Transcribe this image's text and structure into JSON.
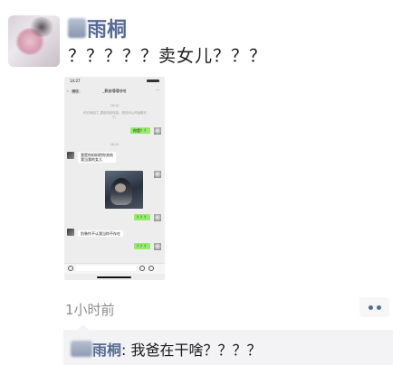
{
  "post": {
    "author_name": "雨桐",
    "text": "？？？？？卖女儿？？？",
    "time_ago": "1小时前"
  },
  "screenshot": {
    "status_time": "14:27",
    "back_label": "微信",
    "chat_title": "_颗皮嘻嘻哈哈",
    "time1": "16:10",
    "system_note": "你已添加了_颗皮嘻嘻哈哈，现在可以开始聊天了。",
    "msg_green1": "你是？？",
    "time2": "16:20",
    "msg_white1": "我是你妈妈把你卖给我当我的女儿",
    "msg_green2": "？？？",
    "msg_white2": "别装作不认我当你不存在",
    "msg_green3": "？？？"
  },
  "comment": {
    "author_name": "雨桐",
    "text": ": 我爸在干啥？？？？"
  },
  "colors": {
    "link_blue": "#576b95",
    "green_bubble": "#95ec69",
    "comment_bg": "#f3f3f5"
  }
}
